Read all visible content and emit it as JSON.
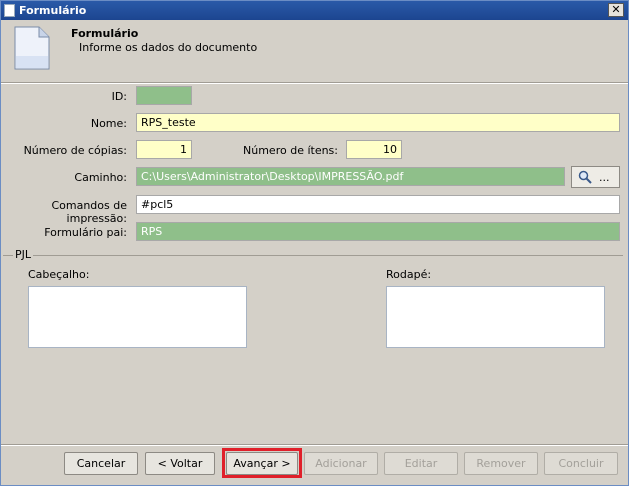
{
  "window": {
    "title": "Formulário",
    "close_glyph": "✕"
  },
  "header": {
    "title": "Formulário",
    "subtitle": "Informe os dados do documento",
    "icon": "document-icon"
  },
  "form": {
    "id": {
      "label": "ID:",
      "value": ""
    },
    "nome": {
      "label": "Nome:",
      "value": "RPS_teste"
    },
    "copias": {
      "label": "Número de cópias:",
      "value": "1"
    },
    "itens": {
      "label": "Número de ítens:",
      "value": "10"
    },
    "caminho": {
      "label": "Caminho:",
      "value": "C:\\Users\\Administrator\\Desktop\\IMPRESSÃO.pdf",
      "browse_label": "..."
    },
    "comandos": {
      "label": "Comandos de impressão:",
      "value": "#pcl5"
    },
    "formulario_pai": {
      "label": "Formulário pai:",
      "value": "RPS"
    }
  },
  "pjl": {
    "group_label": "PJL",
    "cabecalho_label": "Cabeçalho:",
    "rodape_label": "Rodapé:"
  },
  "buttons": {
    "cancelar": "Cancelar",
    "voltar": "< Voltar",
    "avancar": "Avançar >",
    "adicionar": "Adicionar",
    "editar": "Editar",
    "remover": "Remover",
    "concluir": "Concluir"
  },
  "colors": {
    "field_yellow": "#ffffc8",
    "field_green": "#8fbf8a",
    "highlight": "#e0202a"
  }
}
